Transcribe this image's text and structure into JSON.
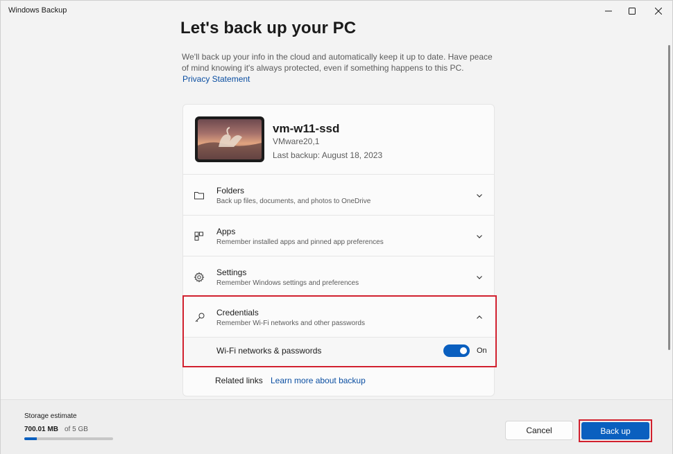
{
  "window": {
    "title": "Windows Backup"
  },
  "page": {
    "heading": "Let's back up your PC",
    "description": "We'll back up your info in the cloud and automatically keep it up to date. Have peace of mind knowing it's always protected, even if something happens to this PC.",
    "privacy_link": "Privacy Statement"
  },
  "device": {
    "name": "vm-w11-ssd",
    "model": "VMware20,1",
    "last_backup": "Last backup: August 18, 2023"
  },
  "sections": [
    {
      "title": "Folders",
      "subtitle": "Back up files, documents, and photos to OneDrive",
      "icon": "folder-icon",
      "expanded": false
    },
    {
      "title": "Apps",
      "subtitle": "Remember installed apps and pinned app preferences",
      "icon": "apps-icon",
      "expanded": false
    },
    {
      "title": "Settings",
      "subtitle": "Remember Windows settings and preferences",
      "icon": "gear-icon",
      "expanded": false
    },
    {
      "title": "Credentials",
      "subtitle": "Remember Wi-Fi networks and other passwords",
      "icon": "key-icon",
      "expanded": true
    }
  ],
  "credentials_option": {
    "label": "Wi-Fi networks & passwords",
    "state": "On",
    "enabled": true
  },
  "related": {
    "label": "Related links",
    "link": "Learn more about backup"
  },
  "storage": {
    "label": "Storage estimate",
    "used": "700.01 MB",
    "total": "of 5 GB",
    "fraction_used": 0.14
  },
  "buttons": {
    "cancel": "Cancel",
    "backup": "Back up"
  },
  "colors": {
    "accent": "#0a5fbf",
    "link": "#0a4ea1",
    "highlight_border": "#d1202e"
  }
}
